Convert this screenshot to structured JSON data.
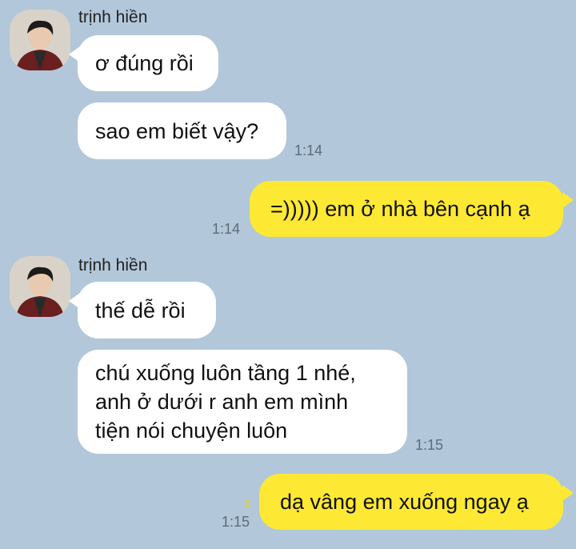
{
  "colors": {
    "background": "#b2c7d9",
    "incoming_bubble": "#ffffff",
    "outgoing_bubble": "#fde934",
    "timestamp": "#5d6b78",
    "unread_count": "#e8d41a"
  },
  "groups": [
    {
      "sender": "trịnh hiền",
      "avatar_icon": "profile-photo-icon",
      "messages": [
        {
          "text": "ơ đúng rồi",
          "time": ""
        },
        {
          "text": "sao em biết vậy?",
          "time": "1:14"
        }
      ]
    },
    {
      "sender": "trịnh hiền",
      "avatar_icon": "profile-photo-icon",
      "messages": [
        {
          "text": "thế dễ rồi",
          "time": ""
        },
        {
          "text": "chú xuống luôn tầng 1 nhé,\nanh ở dưới r anh em mình\ntiện nói chuyện luôn",
          "time": "1:15"
        }
      ]
    }
  ],
  "outgoing": [
    {
      "text": "=))))) em ở nhà bên cạnh ạ",
      "time": "1:14",
      "unread": ""
    },
    {
      "text": "dạ vâng em xuống ngay ạ",
      "time": "1:15",
      "unread": "1"
    }
  ]
}
